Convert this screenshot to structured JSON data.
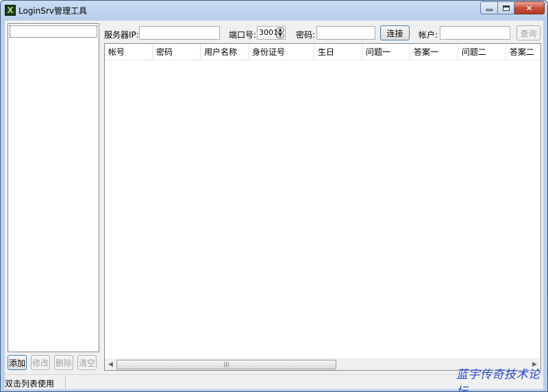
{
  "window": {
    "title": "LoginSrv管理工具",
    "icon": "X",
    "close_glyph": "✕"
  },
  "left_panel": {
    "buttons": [
      {
        "label": "添加",
        "enabled": true
      },
      {
        "label": "修改",
        "enabled": false
      },
      {
        "label": "删除",
        "enabled": false
      },
      {
        "label": "清空",
        "enabled": false
      }
    ]
  },
  "toolbar": {
    "server_ip_label": "服务器IP:",
    "server_ip_value": "",
    "port_label": "端口号:",
    "port_value": "3001",
    "password_label": "密码:",
    "password_value": "",
    "connect_label": "连接",
    "account_label": "帐户:",
    "account_value": "",
    "query_label": "查询"
  },
  "table": {
    "columns": [
      "帐号",
      "密码",
      "用户名称",
      "身份证号",
      "生日",
      "问题一",
      "答案一",
      "问题二",
      "答案二"
    ],
    "rows": [],
    "hscroll_grip": "|||"
  },
  "statusbar": {
    "text": "双击列表使用"
  },
  "watermark": "蓝宇传奇技术论坛"
}
